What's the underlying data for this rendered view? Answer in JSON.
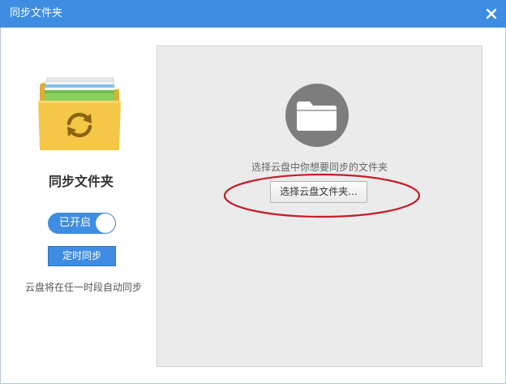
{
  "window": {
    "title": "同步文件夹",
    "close_icon": "close-icon"
  },
  "left_panel": {
    "heading": "同步文件夹",
    "toggle_label": "已开启",
    "toggle_on": true,
    "schedule_button_label": "定时同步",
    "auto_sync_note": "云盘将在任一时段自动同步"
  },
  "main_panel": {
    "hint": "选择云盘中你想要同步的文件夹",
    "select_button_label": "选择云盘文件夹..."
  },
  "colors": {
    "titlebar": "#3f8de2",
    "accent": "#3f8de2",
    "panel_background": "#ebebeb",
    "folder_yellow": "#f5c746",
    "annotation_red": "#c41e2a"
  }
}
